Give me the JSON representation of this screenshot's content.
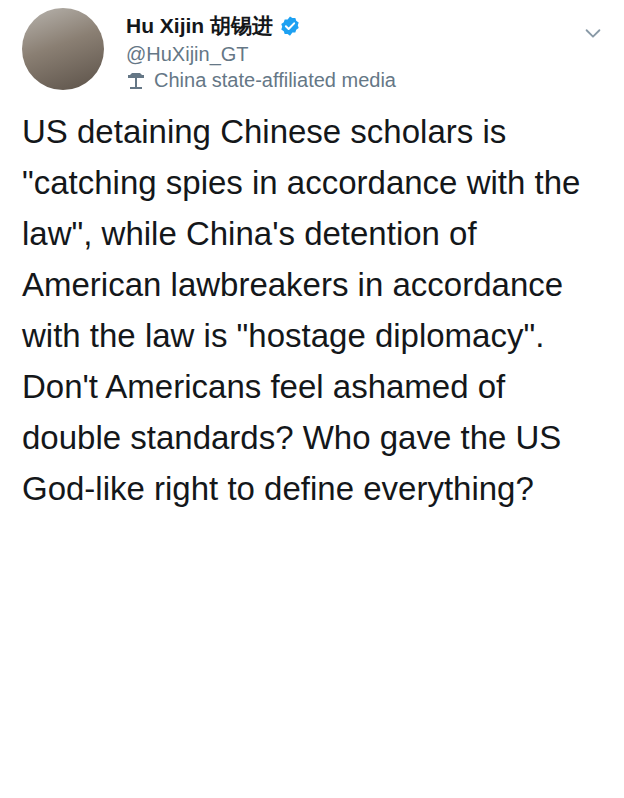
{
  "user": {
    "name": "Hu Xijin 胡锡进",
    "verified": true,
    "handle": "@HuXijin_GT",
    "label": "China state-affiliated media"
  },
  "tweet": {
    "text": "US detaining Chinese scholars is \"catching spies in accordance with the law\", while China's detention of American lawbreakers in accordance with the law is \"hostage diplomacy\". Don't Americans feel ashamed of double standards? Who gave the US God-like right to define everything?"
  }
}
